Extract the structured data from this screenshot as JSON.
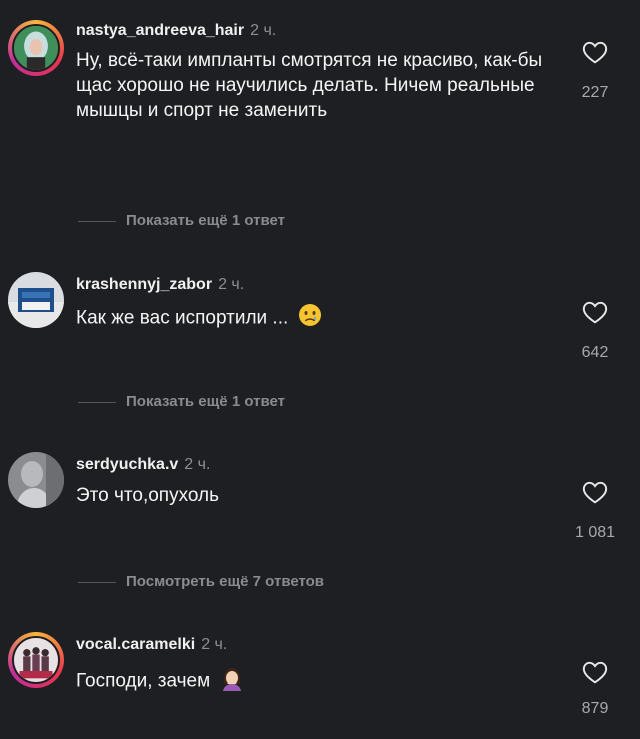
{
  "comments": [
    {
      "username": "nastya_andreeva_hair",
      "time": "2 ч.",
      "text": "Ну, всё-таки импланты смотрятся не красиво, как-бы щас хорошо не научились делать. Ничем реальные мышцы и спорт не заменить",
      "likes": "227",
      "replies_label": "Показать ещё 1 ответ"
    },
    {
      "username": "krashennyj_zabor",
      "time": "2 ч.",
      "text": "Как же вас испортили ...",
      "emoji": "crying-face",
      "likes": "642",
      "replies_label": "Показать ещё 1 ответ"
    },
    {
      "username": "serdyuchka.v",
      "time": "2 ч.",
      "text": "Это что,опухоль",
      "likes": "1 081",
      "replies_label": "Посмотреть ещё 7 ответов"
    },
    {
      "username": "vocal.caramelki",
      "time": "2 ч.",
      "text": "Господи, зачем",
      "emoji": "facepalm-woman",
      "likes": "879"
    }
  ],
  "colors": {
    "background": "#1e1f23",
    "muted": "#8e8e93",
    "story_ring": "#e8344e"
  }
}
